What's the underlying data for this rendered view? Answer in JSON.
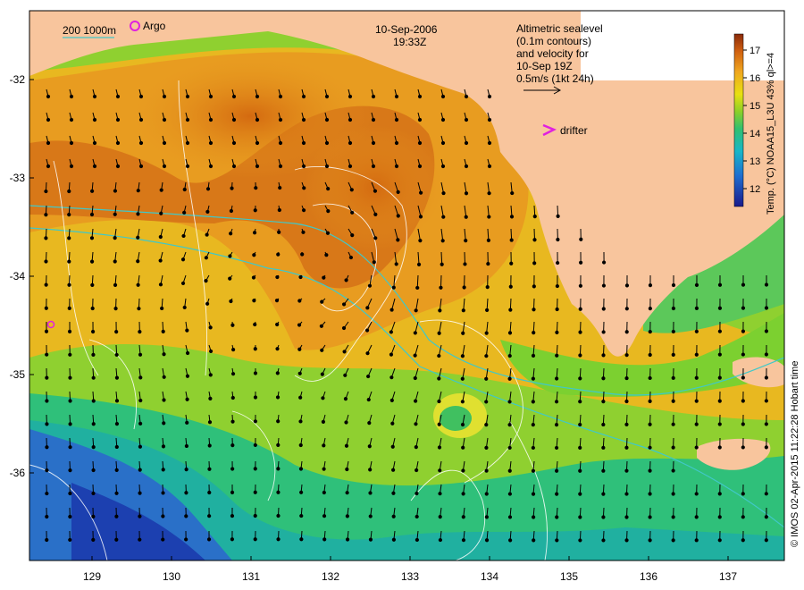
{
  "header": {
    "date": "10-Sep-2006",
    "time": "19:33Z"
  },
  "legend": {
    "isobath_label": "200  1000m",
    "argo_label": "Argo",
    "drifter_label": "drifter",
    "info_lines": [
      "Altimetric sealevel",
      "(0.1m contours)",
      "and velocity for",
      "10-Sep 19Z",
      "0.5m/s (1kt 24h)"
    ]
  },
  "colorbar": {
    "title": "Temp. (°C) NOAA15_L3U 43% ql>=4",
    "ticks": [
      "12",
      "13",
      "14",
      "15",
      "16",
      "17"
    ]
  },
  "axes": {
    "x_ticks": [
      "129",
      "130",
      "131",
      "132",
      "133",
      "134",
      "135",
      "136",
      "137"
    ],
    "y_ticks": [
      "-32",
      "-33",
      "-34",
      "-35",
      "-36"
    ]
  },
  "credit": "© IMOS 02-Apr-2015 11:22:28 Hobart time",
  "colors": {
    "land": "#f8c59d",
    "isobath": "#40c8c8",
    "argo": "#e020e0",
    "drifter": "#e020e0"
  }
}
